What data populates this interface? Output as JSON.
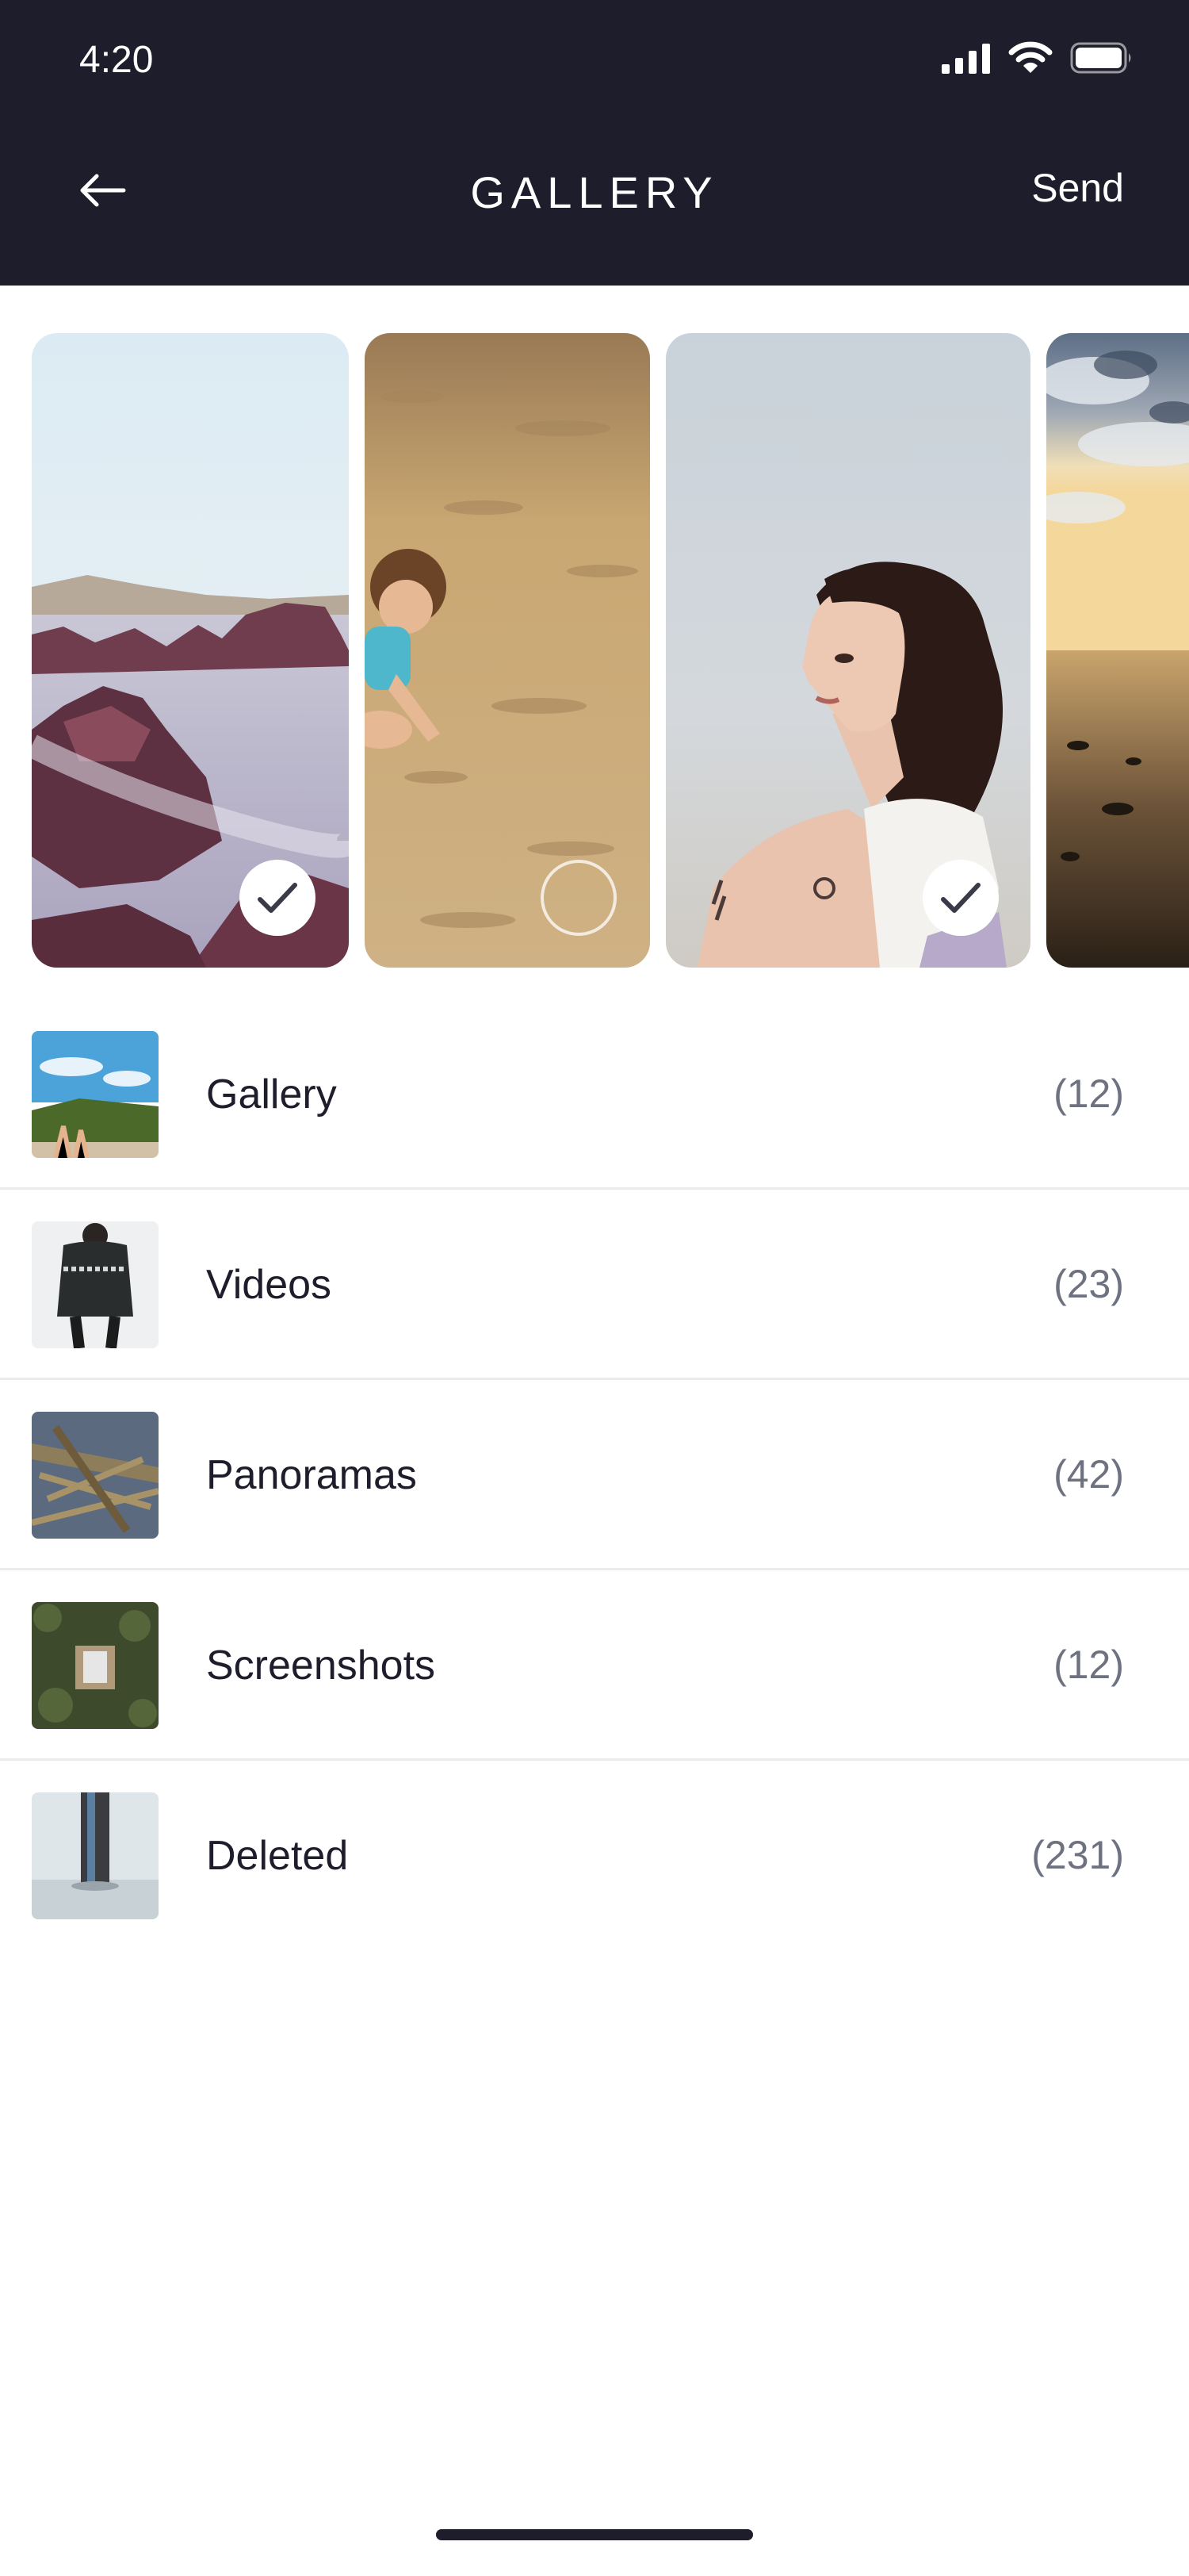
{
  "status_bar": {
    "time": "4:20"
  },
  "header": {
    "title": "GALLERY",
    "send_label": "Send"
  },
  "photos": [
    {
      "name": "rocky-shore",
      "selected": true
    },
    {
      "name": "child-in-sand",
      "selected": false
    },
    {
      "name": "woman-portrait",
      "selected": true
    },
    {
      "name": "sunset-beach",
      "selected": false
    }
  ],
  "albums": [
    {
      "name": "Gallery",
      "count": "(12)"
    },
    {
      "name": "Videos",
      "count": "(23)"
    },
    {
      "name": "Panoramas",
      "count": "(42)"
    },
    {
      "name": "Screenshots",
      "count": "(12)"
    },
    {
      "name": "Deleted",
      "count": "(231)"
    }
  ],
  "colors": {
    "header_bg": "#1e1d2b",
    "text": "#1e1d2b",
    "count_text": "#6e7180",
    "divider": "#ececf0",
    "check_mark": "#3a3a48"
  }
}
